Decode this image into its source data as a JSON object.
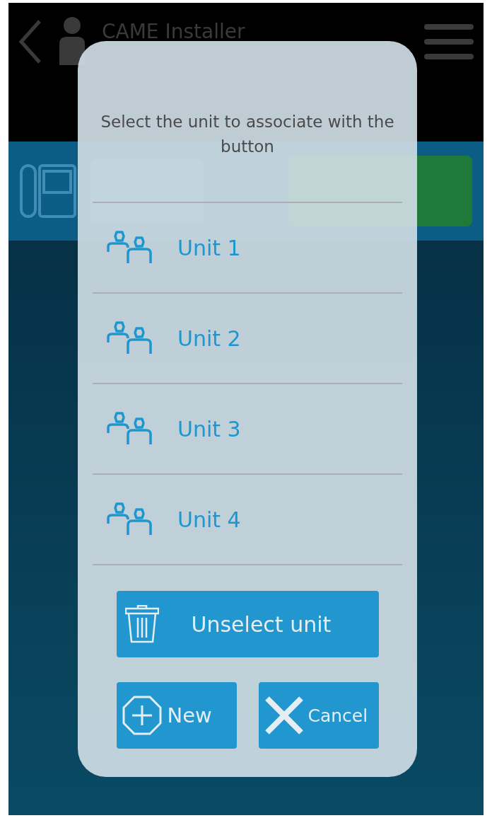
{
  "app_bar": {
    "title": "CAME Installer"
  },
  "dialog": {
    "message": "Select the unit to associate with the button",
    "units": [
      {
        "label": "Unit 1"
      },
      {
        "label": "Unit 2"
      },
      {
        "label": "Unit 3"
      },
      {
        "label": "Unit 4"
      }
    ],
    "unselect_button": {
      "label": "Unselect unit"
    },
    "new_button": {
      "label": "New"
    },
    "cancel_button": {
      "label": "Cancel"
    }
  }
}
